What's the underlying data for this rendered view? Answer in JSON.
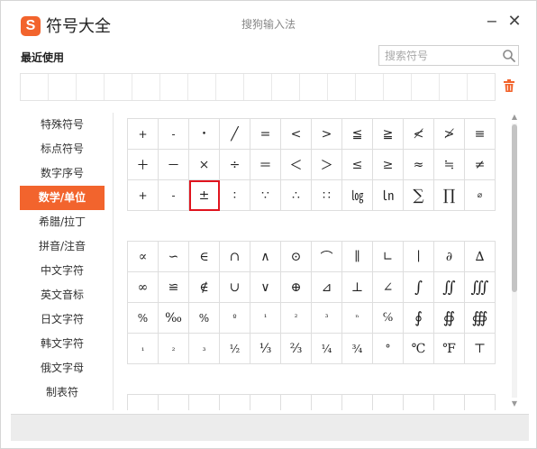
{
  "app": {
    "logo_text": "S",
    "title": "符号大全",
    "window_title": "搜狗输入法"
  },
  "window_controls": {
    "minimize": "−",
    "close": "✕"
  },
  "recent": {
    "label": "最近使用",
    "slot_count": 17
  },
  "search": {
    "placeholder": "搜索符号",
    "value": ""
  },
  "categories": [
    {
      "label": "特殊符号",
      "active": false
    },
    {
      "label": "标点符号",
      "active": false
    },
    {
      "label": "数字序号",
      "active": false
    },
    {
      "label": "数学/单位",
      "active": true
    },
    {
      "label": "希腊/拉丁",
      "active": false
    },
    {
      "label": "拼音/注音",
      "active": false
    },
    {
      "label": "中文字符",
      "active": false
    },
    {
      "label": "英文音标",
      "active": false
    },
    {
      "label": "日文字符",
      "active": false
    },
    {
      "label": "韩文字符",
      "active": false
    },
    {
      "label": "俄文字母",
      "active": false
    },
    {
      "label": "制表符",
      "active": false
    }
  ],
  "symbols": {
    "group1": [
      "+",
      "-",
      "•",
      "╱",
      "=",
      "<",
      ">",
      "≦",
      "≧",
      "≮",
      "≯",
      "≡",
      "＋",
      "－",
      "×",
      "÷",
      "＝",
      "＜",
      "＞",
      "≤",
      "≥",
      "≈",
      "≒",
      "≠",
      "+",
      "-",
      "±",
      "∶",
      "∵",
      "∴",
      "∷",
      "㏒",
      "㏑",
      "∑",
      "∏",
      "⌀"
    ],
    "group2": [
      "∝",
      "∽",
      "∈",
      "∩",
      "∧",
      "⊙",
      "⌒",
      "∥",
      "∟",
      "∣",
      "∂",
      "∆",
      "∞",
      "≌",
      "∉",
      "∪",
      "∨",
      "⊕",
      "⊿",
      "⊥",
      "∠",
      "∫",
      "∬",
      "∭",
      "%",
      "‰",
      "%",
      "º",
      "¹",
      "²",
      "³",
      "ⁿ",
      "℅",
      "∮",
      "∯",
      "∰",
      "₁",
      "₂",
      "₃",
      "½",
      "⅓",
      "⅔",
      "¼",
      "¾",
      "°",
      "℃",
      "℉",
      "⊤"
    ],
    "group3": [
      "",
      "",
      "",
      "",
      "",
      "",
      "",
      "",
      "",
      "",
      "",
      ""
    ]
  },
  "selected_symbol": "±",
  "colors": {
    "accent": "#f2642d",
    "selection": "#e0141e",
    "border": "#dedede"
  },
  "icons": {
    "search": "search-icon",
    "trash": "trash-icon",
    "scroll_up": "▲",
    "scroll_down": "▼"
  }
}
